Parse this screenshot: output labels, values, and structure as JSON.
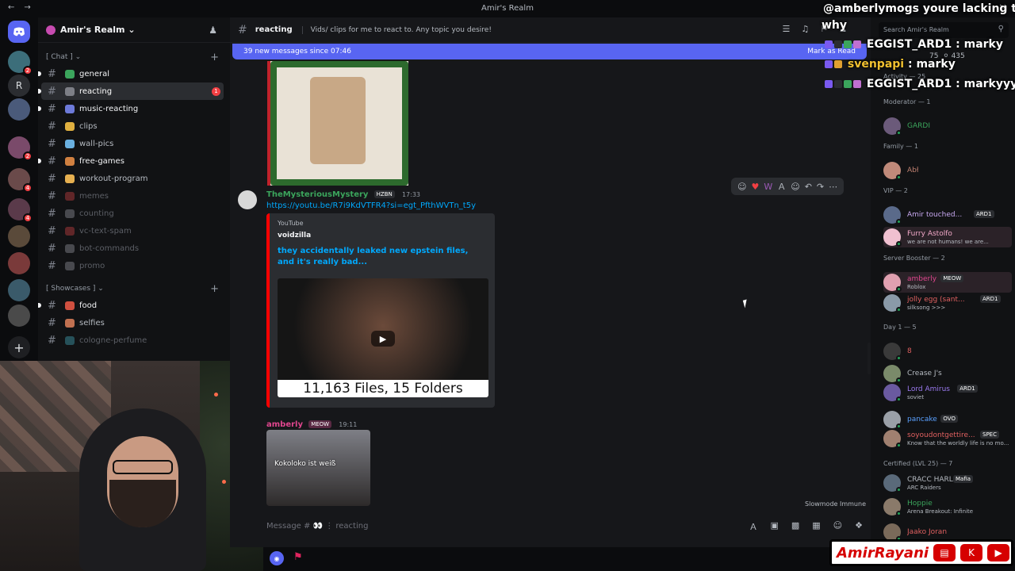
{
  "titlebar": {
    "title": "Amir's Realm",
    "back": "←",
    "forward": "→",
    "close": "✕"
  },
  "servers": [
    {
      "label": "",
      "badge": "2"
    },
    {
      "label": "R",
      "badge": ""
    },
    {
      "label": "",
      "badge": ""
    },
    {
      "label": "",
      "badge": "2"
    },
    {
      "label": "",
      "badge": "4"
    },
    {
      "label": "",
      "badge": "4"
    },
    {
      "label": "",
      "badge": ""
    },
    {
      "label": "",
      "badge": ""
    },
    {
      "label": "",
      "badge": ""
    },
    {
      "label": "",
      "badge": ""
    }
  ],
  "guild": {
    "name": "Amir's Realm ⌄"
  },
  "categories": {
    "chat": "[ Chat ] ⌄",
    "showcases": "[ Showcases ] ⌄"
  },
  "channels_chat": [
    {
      "name": "general",
      "color": "#3ba55c",
      "state": "unread"
    },
    {
      "name": "reacting",
      "color": "#7d7f86",
      "state": "active",
      "count": "1"
    },
    {
      "name": "music-reacting",
      "color": "#6d7ad9",
      "state": "unread"
    },
    {
      "name": "clips",
      "color": "#e0b040",
      "state": "normal"
    },
    {
      "name": "wall-pics",
      "color": "#6ab0e0",
      "state": "normal"
    },
    {
      "name": "free-games",
      "color": "#d08040",
      "state": "unread"
    },
    {
      "name": "workout-program",
      "color": "#e6b050",
      "state": "normal"
    },
    {
      "name": "memes",
      "color": "#c04040",
      "state": "muted"
    },
    {
      "name": "counting",
      "color": "#8c8f94",
      "state": "muted"
    },
    {
      "name": "vc-text-spam",
      "color": "#c04040",
      "state": "muted"
    },
    {
      "name": "bot-commands",
      "color": "#8c8f94",
      "state": "muted"
    },
    {
      "name": "promo",
      "color": "#8c8f94",
      "state": "muted"
    }
  ],
  "channels_showcase": [
    {
      "name": "food",
      "color": "#d05040",
      "state": "unread"
    },
    {
      "name": "selfies",
      "color": "#c07050",
      "state": "normal"
    },
    {
      "name": "cologne-perfume",
      "color": "#40a0b0",
      "state": "muted"
    }
  ],
  "chat": {
    "channel_name": "reacting",
    "topic": "Vids/ clips for me to react to. Any topic you desire!",
    "new_messages": "39 new messages since 07:46",
    "mark_read": "Mark as Read",
    "composer_placeholder": "Message # 👀 ⋮ reacting",
    "slowmode": "Slowmode Immune"
  },
  "messages": [
    {
      "author": "TheMysteriousMystery",
      "author_color": "#3ba55c",
      "tag": "HZBN",
      "time": "17:33",
      "link": "https://youtu.be/R7i9KdVTFR4?si=egt_PfthWVTn_t5y",
      "embed": {
        "provider": "YouTube",
        "author": "voidzilla",
        "title": "they accidentally leaked new epstein files, and it's really bad...",
        "caption": "11,163 Files, 15 Folders"
      }
    },
    {
      "author": "amberly",
      "author_color": "#e0468e",
      "tag": "MEOW",
      "time": "19:11",
      "image_caption": "Kokoloko ist weiß"
    }
  ],
  "members": {
    "search_placeholder": "Search Amir's Realm",
    "activity": "Activity — 25",
    "groups": [
      {
        "title": "Moderator — 1",
        "members": [
          {
            "name": "GARDI",
            "color": "#3ba55c",
            "sub": "",
            "tag": ""
          }
        ]
      },
      {
        "title": "Family — 1",
        "members": [
          {
            "name": "Abł",
            "color": "#c08070",
            "sub": "",
            "tag": ""
          }
        ]
      },
      {
        "title": "VIP — 2",
        "members": [
          {
            "name": "Amir touched...",
            "color": "#c7a8f0",
            "sub": "",
            "tag": "ARD1"
          },
          {
            "name": "Furry Astolfo",
            "color": "#f2a8c8",
            "sub": "we are not humans! we are...",
            "tag": ""
          }
        ]
      },
      {
        "title": "Server Booster — 2",
        "members": [
          {
            "name": "amberly",
            "color": "#e0468e",
            "sub": "Roblox",
            "tag": "MEOW"
          },
          {
            "name": "jolly egg (sant...",
            "color": "#e06060",
            "sub": "silksong >>>",
            "tag": "ARD1"
          }
        ]
      },
      {
        "title": "Day 1 — 5",
        "members": [
          {
            "name": "8",
            "color": "#e06060",
            "sub": "",
            "tag": ""
          },
          {
            "name": "Crease J's",
            "color": "#b5bac1",
            "sub": "",
            "tag": ""
          },
          {
            "name": "Lord Amirus",
            "color": "#9b7af0",
            "sub": "soviet",
            "tag": "ARD1"
          },
          {
            "name": "pancake",
            "color": "#5aa0ff",
            "sub": "",
            "tag": "OVO"
          },
          {
            "name": "soyoudontgettire...",
            "color": "#e06060",
            "sub": "Know that the worldly life is no mo...",
            "tag": "SPEC"
          }
        ]
      },
      {
        "title": "Certified (LVL 25) — 7",
        "members": [
          {
            "name": "CRACC HARL",
            "color": "#b5bac1",
            "sub": "ARC Raiders",
            "tag": "Mafia"
          },
          {
            "name": "Hoppie",
            "color": "#3ba55c",
            "sub": "Arena Breakout: Infinite",
            "tag": ""
          },
          {
            "name": "Jaako Joran",
            "color": "#e06060",
            "sub": "",
            "tag": ""
          }
        ]
      }
    ]
  },
  "overlay": {
    "line1": "@amberlymogs youre lacking thats",
    "line1b": "why",
    "line2_name": "EGGIST_ARD1",
    "line2_msg": "marky",
    "line3_name": "svenpapi",
    "line3_msg": "marky",
    "line4_name": "EGGIST_ARD1",
    "line4_msg": "markyyy",
    "counts": "75",
    "counts2": "435"
  },
  "brand": {
    "name": "AmirRayani"
  },
  "colors": {
    "accent": "#5865f2",
    "danger": "#f23f43",
    "online": "#23a55a",
    "link": "#00a8fc"
  }
}
